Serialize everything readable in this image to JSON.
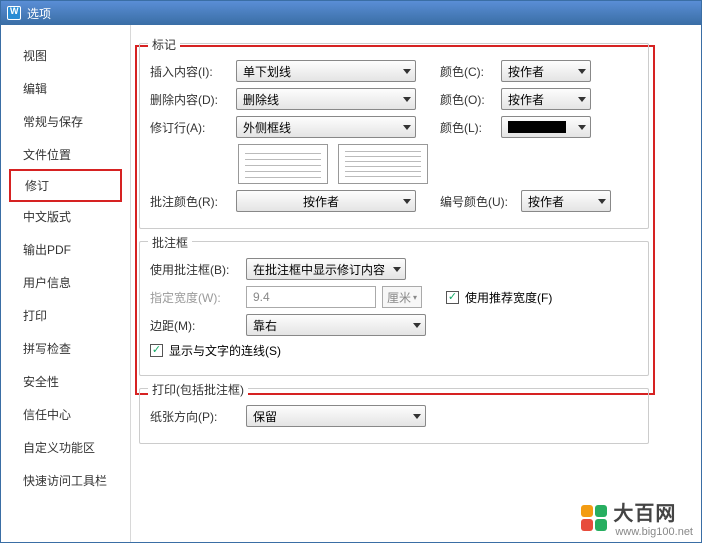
{
  "window": {
    "title": "选项"
  },
  "sidebar": {
    "items": [
      {
        "label": "视图"
      },
      {
        "label": "编辑"
      },
      {
        "label": "常规与保存"
      },
      {
        "label": "文件位置"
      },
      {
        "label": "修订"
      },
      {
        "label": "中文版式"
      },
      {
        "label": "输出PDF"
      },
      {
        "label": "用户信息"
      },
      {
        "label": "打印"
      },
      {
        "label": "拼写检查"
      },
      {
        "label": "安全性"
      },
      {
        "label": "信任中心"
      },
      {
        "label": "自定义功能区"
      },
      {
        "label": "快速访问工具栏"
      }
    ]
  },
  "mark": {
    "legend": "标记",
    "insert_label": "插入内容(I):",
    "insert_value": "单下划线",
    "color_label_c": "颜色(C):",
    "color_value_c": "按作者",
    "delete_label": "删除内容(D):",
    "delete_value": "删除线",
    "color_label_o": "颜色(O):",
    "color_value_o": "按作者",
    "changedline_label": "修订行(A):",
    "changedline_value": "外侧框线",
    "color_label_l": "颜色(L):",
    "color_swatch": "#000000",
    "comment_color_label": "批注颜色(R):",
    "comment_color_value": "按作者",
    "number_color_label": "编号颜色(U):",
    "number_color_value": "按作者"
  },
  "balloon": {
    "legend": "批注框",
    "use_label": "使用批注框(B):",
    "use_value": "在批注框中显示修订内容",
    "width_label": "指定宽度(W):",
    "width_value": "9.4",
    "width_unit": "厘米",
    "recommend_label": "使用推荐宽度(F)",
    "margin_label": "边距(M):",
    "margin_value": "靠右",
    "showline_label": "显示与文字的连线(S)"
  },
  "print": {
    "legend": "打印(包括批注框)",
    "orient_label": "纸张方向(P):",
    "orient_value": "保留"
  },
  "watermark": {
    "text": "大百网",
    "url": "www.big100.net"
  }
}
